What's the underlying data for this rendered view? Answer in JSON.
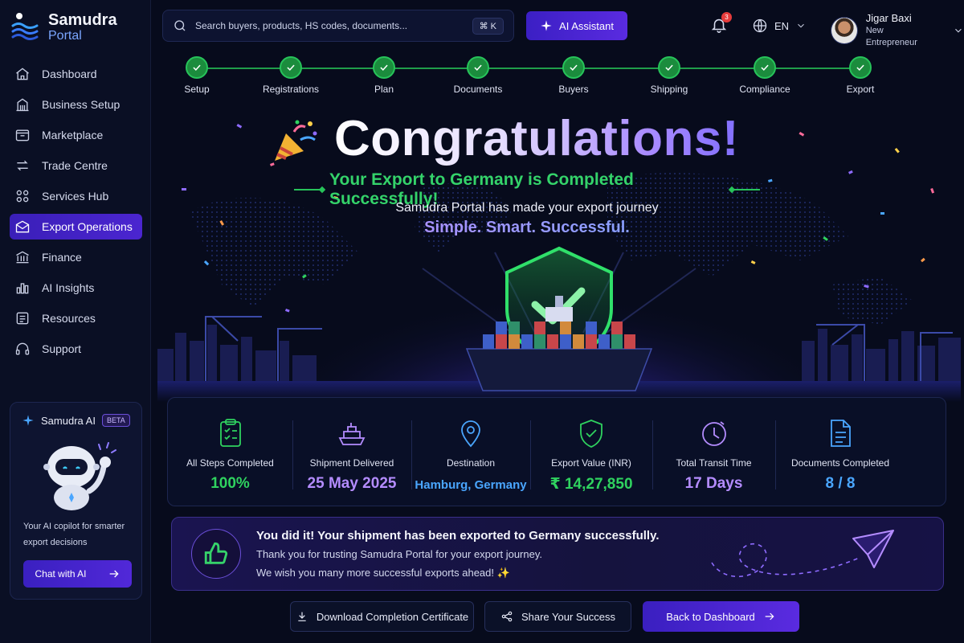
{
  "brand": {
    "name": "Samudra",
    "sub": "Portal"
  },
  "sidebar": {
    "items": [
      {
        "label": "Dashboard",
        "icon": "home-icon"
      },
      {
        "label": "Business Setup",
        "icon": "building-icon"
      },
      {
        "label": "Marketplace",
        "icon": "store-icon"
      },
      {
        "label": "Trade Centre",
        "icon": "exchange-icon"
      },
      {
        "label": "Services Hub",
        "icon": "grid-icon"
      },
      {
        "label": "Export Operations",
        "icon": "export-icon",
        "active": true
      },
      {
        "label": "Finance",
        "icon": "bank-icon"
      },
      {
        "label": "AI Insights",
        "icon": "bar-chart-icon"
      },
      {
        "label": "Resources",
        "icon": "book-icon"
      },
      {
        "label": "Support",
        "icon": "headset-icon"
      }
    ],
    "ai_card": {
      "title": "Samudra AI",
      "badge": "BETA",
      "description": "Your AI copilot for smarter export decisions",
      "button": "Chat with AI"
    }
  },
  "topbar": {
    "search_placeholder": "Search buyers, products, HS codes, documents...",
    "shortcut": "⌘ K",
    "ai_button": "AI Assistant",
    "notification_count": "3",
    "language": "EN",
    "user": {
      "name": "Jigar Baxi",
      "role": "New Entrepreneur"
    }
  },
  "stepper": {
    "steps": [
      "Setup",
      "Registrations",
      "Plan",
      "Documents",
      "Buyers",
      "Shipping",
      "Compliance",
      "Export"
    ],
    "completed": 8
  },
  "hero": {
    "title": "Congratulations!",
    "subtitle": "Your Export to Germany is Completed Successfully!",
    "line": "Samudra Portal has made your export journey",
    "tagline": "Simple. Smart. Successful."
  },
  "stats": [
    {
      "label": "All Steps Completed",
      "value": "100%",
      "color": "#2fd25f",
      "icon": "checklist-icon"
    },
    {
      "label": "Shipment Delivered",
      "value": "25 May 2025",
      "color": "#b48cff",
      "icon": "ship-icon"
    },
    {
      "label": "Destination",
      "value": "Hamburg, Germany",
      "color": "#4aa6ff",
      "icon": "location-pin-icon"
    },
    {
      "label": "Export Value (INR)",
      "value": "₹ 14,27,850",
      "color": "#2fd25f",
      "icon": "shield-check-icon"
    },
    {
      "label": "Total Transit Time",
      "value": "17 Days",
      "color": "#b48cff",
      "icon": "clock-icon"
    },
    {
      "label": "Documents Completed",
      "value": "8 / 8",
      "color": "#4aa6ff",
      "icon": "document-icon"
    }
  ],
  "banner": {
    "headline": "You did it! Your shipment has been exported to Germany successfully.",
    "line1": "Thank you for trusting Samudra Portal for your export journey.",
    "line2": "We wish you many more successful exports ahead! ✨"
  },
  "actions": {
    "download": "Download Completion Certificate",
    "share": "Share Your Success",
    "back": "Back to Dashboard"
  }
}
